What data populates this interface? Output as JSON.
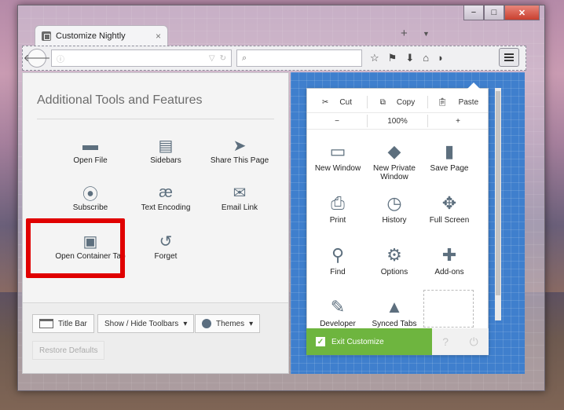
{
  "window": {
    "tab_title": "Customize Nightly",
    "tab_close": "×",
    "new_tab": "+",
    "tab_list": "▼",
    "minimize": "−",
    "maximize": "□",
    "close": "✕"
  },
  "toolbar": {
    "back": "🡐",
    "info": "ⓘ",
    "dropdown": "▽",
    "reload": "↻",
    "search_icon": "⌕",
    "icons": [
      "☆",
      "⚑",
      "⬇",
      "⌂",
      "◗"
    ]
  },
  "palette": {
    "title": "Additional Tools and Features",
    "items": [
      {
        "label": "Open File",
        "icon": "folder-icon",
        "glyph": "▬"
      },
      {
        "label": "Sidebars",
        "icon": "sidebar-icon",
        "glyph": "▤"
      },
      {
        "label": "Share This Page",
        "icon": "share-icon",
        "glyph": "➤"
      },
      {
        "label": "Subscribe",
        "icon": "rss-icon",
        "glyph": "⦿"
      },
      {
        "label": "Text Encoding",
        "icon": "encoding-icon",
        "glyph": "æ"
      },
      {
        "label": "Email Link",
        "icon": "email-icon",
        "glyph": "✉"
      },
      {
        "label": "Open Container Tab",
        "icon": "container-tab-icon",
        "glyph": "▣"
      },
      {
        "label": "Forget",
        "icon": "forget-icon",
        "glyph": "↺"
      }
    ],
    "footer": {
      "title_bar": "Title Bar",
      "toolbars": "Show / Hide Toolbars",
      "themes": "Themes",
      "restore": "Restore Defaults",
      "caret": "▾"
    }
  },
  "menu_panel": {
    "edit": {
      "cut": "Cut",
      "copy": "Copy",
      "paste": "Paste"
    },
    "zoom": {
      "minus": "−",
      "level": "100%",
      "plus": "+"
    },
    "items": [
      {
        "label": "New Window",
        "icon": "new-window-icon",
        "glyph": "▭"
      },
      {
        "label": "New Private Window",
        "icon": "private-mask-icon",
        "glyph": "◆"
      },
      {
        "label": "Save Page",
        "icon": "save-page-icon",
        "glyph": "▮"
      },
      {
        "label": "Print",
        "icon": "print-icon",
        "glyph": "⎙"
      },
      {
        "label": "History",
        "icon": "history-icon",
        "glyph": "◷"
      },
      {
        "label": "Full Screen",
        "icon": "fullscreen-icon",
        "glyph": "✥"
      },
      {
        "label": "Find",
        "icon": "find-icon",
        "glyph": "⚲"
      },
      {
        "label": "Options",
        "icon": "options-gear-icon",
        "glyph": "⚙"
      },
      {
        "label": "Add-ons",
        "icon": "addons-puzzle-icon",
        "glyph": "✚"
      },
      {
        "label": "Developer",
        "icon": "developer-wrench-icon",
        "glyph": "✎"
      },
      {
        "label": "Synced Tabs",
        "icon": "synced-tabs-icon",
        "glyph": "▲"
      }
    ],
    "exit": "Exit Customize",
    "help": "?",
    "quit": "⏻"
  }
}
